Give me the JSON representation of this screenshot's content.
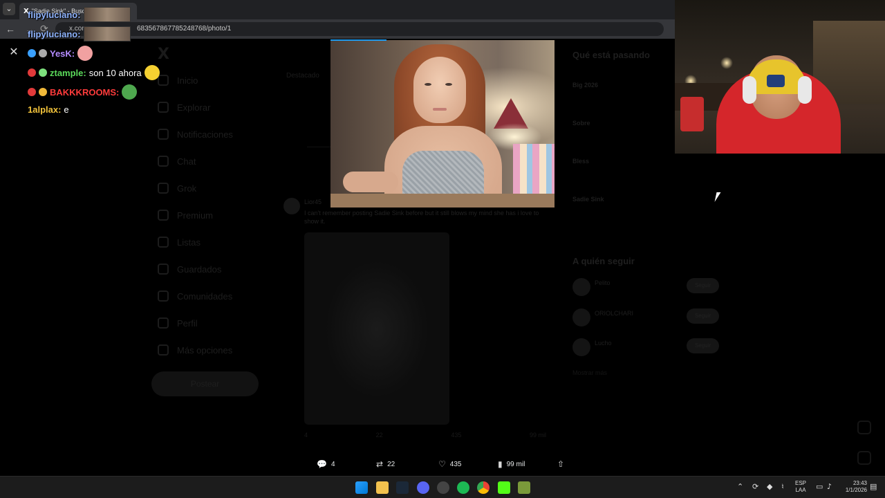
{
  "browser": {
    "tab_favicon": "X",
    "tab_title": "\"Sadie Sink\" - Buscar /",
    "url_prefix": "x.com",
    "url_path": "683567867785248768/photo/1"
  },
  "twitter_dimmed": {
    "nav": [
      "Inicio",
      "Explorar",
      "Notificaciones",
      "Chat",
      "Grok",
      "Premium",
      "Listas",
      "Guardados",
      "Comunidades",
      "Perfil",
      "Más opciones"
    ],
    "post_button": "Postear",
    "feed_tab": "Destacado",
    "tweet": {
      "user": "Lior45",
      "text": "I can't remember posting Sadie Sink before but it still blows my mind she has i love to show it."
    },
    "tweet_actions": [
      "4",
      "22",
      "435",
      "99 mil"
    ],
    "right": {
      "title": "Qué está pasando",
      "trends": [
        "Big 2026",
        "Sobre",
        "Bless",
        "Sadie Sink"
      ],
      "follow_title": "A quién seguir",
      "follow": [
        {
          "name": "Pelito",
          "button": "Seguir"
        },
        {
          "name": "ORIOLCHARI",
          "button": "Seguir"
        },
        {
          "name": "Lucho",
          "button": "Seguir"
        }
      ],
      "more": "Mostrar más"
    }
  },
  "lightbox": {
    "close_icon": "close-icon",
    "actions": {
      "replies": "4",
      "reposts": "22",
      "likes": "435",
      "views": "99 mil"
    }
  },
  "chat": {
    "header_user": "flipyluciano:",
    "lines": [
      {
        "user": "flipyluciano:",
        "message": "",
        "color": "#8fb4ff"
      },
      {
        "user": "flipyluciano:",
        "message": "",
        "color": "#8fb4ff"
      },
      {
        "user": "YesK:",
        "message": "",
        "color": "#b48cff"
      },
      {
        "user": "ztample:",
        "message": "son 10 ahora",
        "color": "#5bd95b"
      },
      {
        "user": "BAKKKROOMS:",
        "message": "",
        "color": "#ff3b3b"
      },
      {
        "user": "1alplax:",
        "message": "e",
        "color": "#f2c33b"
      }
    ]
  },
  "taskbar": {
    "lang_top": "ESP",
    "lang_bottom": "LAA",
    "time": "23:43",
    "date": "1/1/2026"
  },
  "colors": {
    "accent": "#1d9bf0",
    "taskbar": "#1c1c1c"
  }
}
